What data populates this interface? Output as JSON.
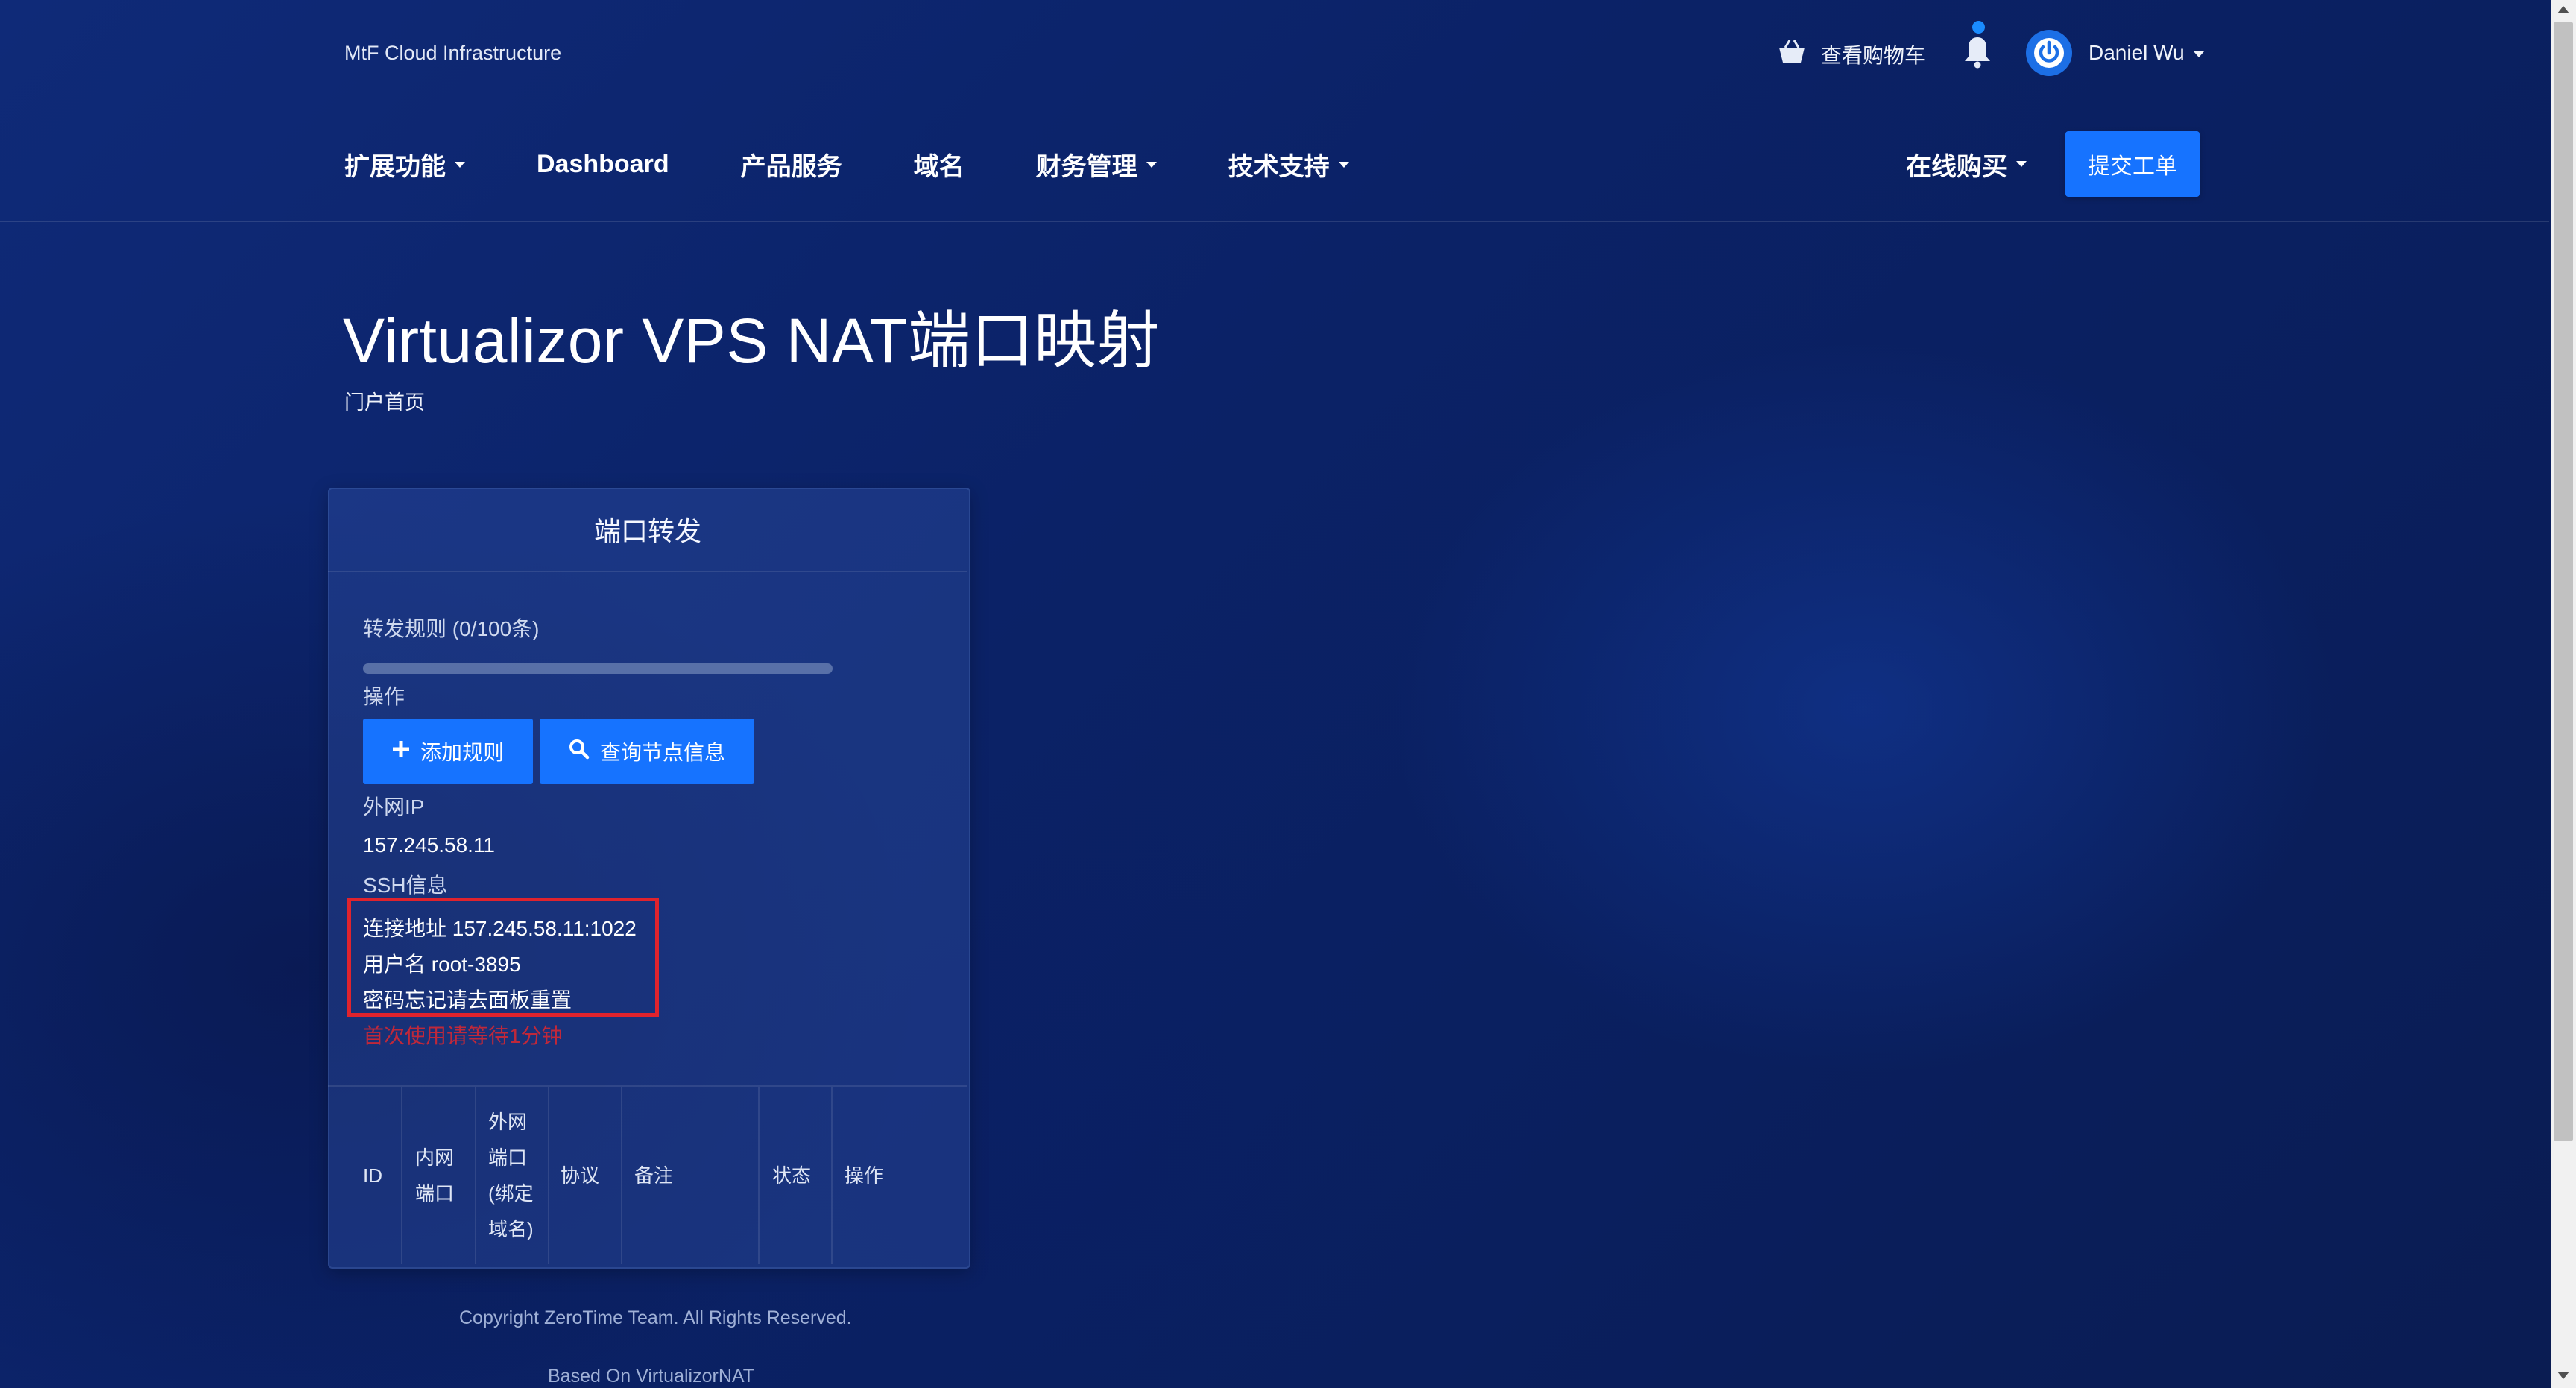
{
  "header": {
    "brand": "MtF Cloud Infrastructure",
    "cart_label": "查看购物车",
    "user_name": "Daniel Wu"
  },
  "nav": {
    "items": [
      {
        "label": "扩展功能",
        "dropdown": true
      },
      {
        "label": "Dashboard",
        "dropdown": false
      },
      {
        "label": "产品服务",
        "dropdown": false
      },
      {
        "label": "域名",
        "dropdown": false
      },
      {
        "label": "财务管理",
        "dropdown": true
      },
      {
        "label": "技术支持",
        "dropdown": true
      }
    ],
    "buy_online": "在线购买",
    "submit_ticket": "提交工单"
  },
  "page": {
    "title": "Virtualizor VPS NAT端口映射",
    "breadcrumb": "门户首页"
  },
  "card": {
    "title": "端口转发",
    "rules_label": "转发规则 (0/100条)",
    "rules_used": 0,
    "rules_total": 100,
    "actions_label": "操作",
    "add_rule": "添加规则",
    "query_node": "查询节点信息",
    "public_ip_label": "外网IP",
    "public_ip": "157.245.58.11",
    "ssh_label": "SSH信息",
    "ssh_address": "连接地址 157.245.58.11:1022",
    "ssh_username": "用户名 root-3895",
    "ssh_password_note": "密码忘记请去面板重置",
    "first_use_warning": "首次使用请等待1分钟"
  },
  "table": {
    "headers": {
      "id": "ID",
      "internal_port": [
        "内网",
        "端口"
      ],
      "external_port": [
        "外网",
        "端口",
        "(绑定",
        "域名)"
      ],
      "protocol": "协议",
      "remark": "备注",
      "status": "状态",
      "action": "操作"
    }
  },
  "footer": {
    "copyright": "Copyright ZeroTime Team. All Rights Reserved.",
    "based_on": "Based On VirtualizorNAT"
  },
  "colors": {
    "accent": "#1673ff",
    "background": "#0b2267",
    "highlight_box": "#e0232d",
    "warning_text": "#c0283a"
  }
}
